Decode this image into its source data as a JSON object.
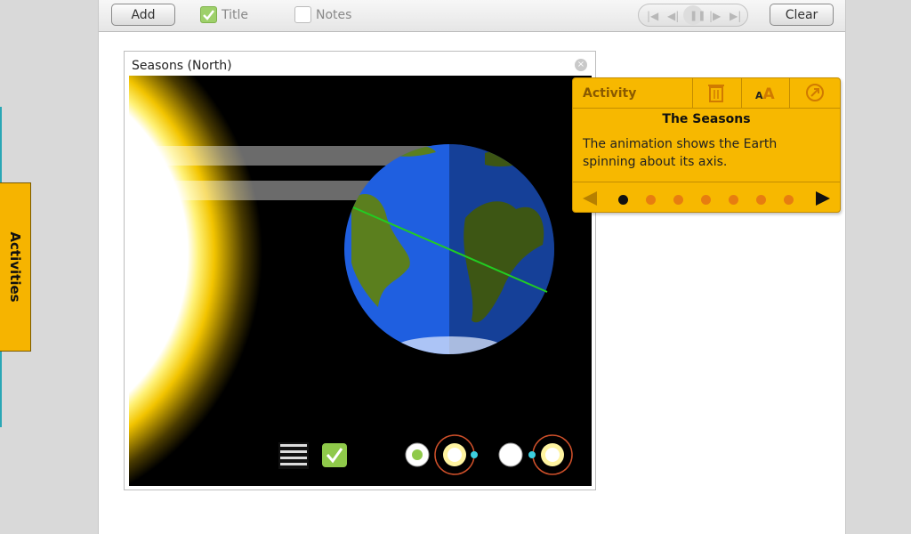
{
  "toolbar": {
    "add_label": "Add",
    "title_toggle": {
      "label": "Title",
      "checked": true
    },
    "notes_toggle": {
      "label": "Notes",
      "checked": false
    },
    "media_controls": [
      "first-icon",
      "prev-icon",
      "pause-icon",
      "next-icon",
      "last-icon"
    ],
    "clear_label": "Clear"
  },
  "sidebar": {
    "tab_label": "Activities"
  },
  "panel": {
    "title": "Seasons (North)",
    "controls": {
      "lines_icon": "light-rays-icon",
      "check_checked": true,
      "position_a_selected": true,
      "position_b_selected": false
    }
  },
  "activity_card": {
    "header": "Activity",
    "icons": [
      "trash-icon",
      "font-size-icon",
      "arrow-out-icon"
    ],
    "title": "The Seasons",
    "body": "The animation shows the Earth spinning about its axis.",
    "pages": 7,
    "current_page": 1
  },
  "colors": {
    "accent_yellow": "#f7b800",
    "dot_orange": "#e77d10",
    "check_green": "#8fc94a",
    "earth_blue": "#1f5fe0",
    "land_green": "#5b7f1e",
    "axis_green": "#22cc22"
  }
}
